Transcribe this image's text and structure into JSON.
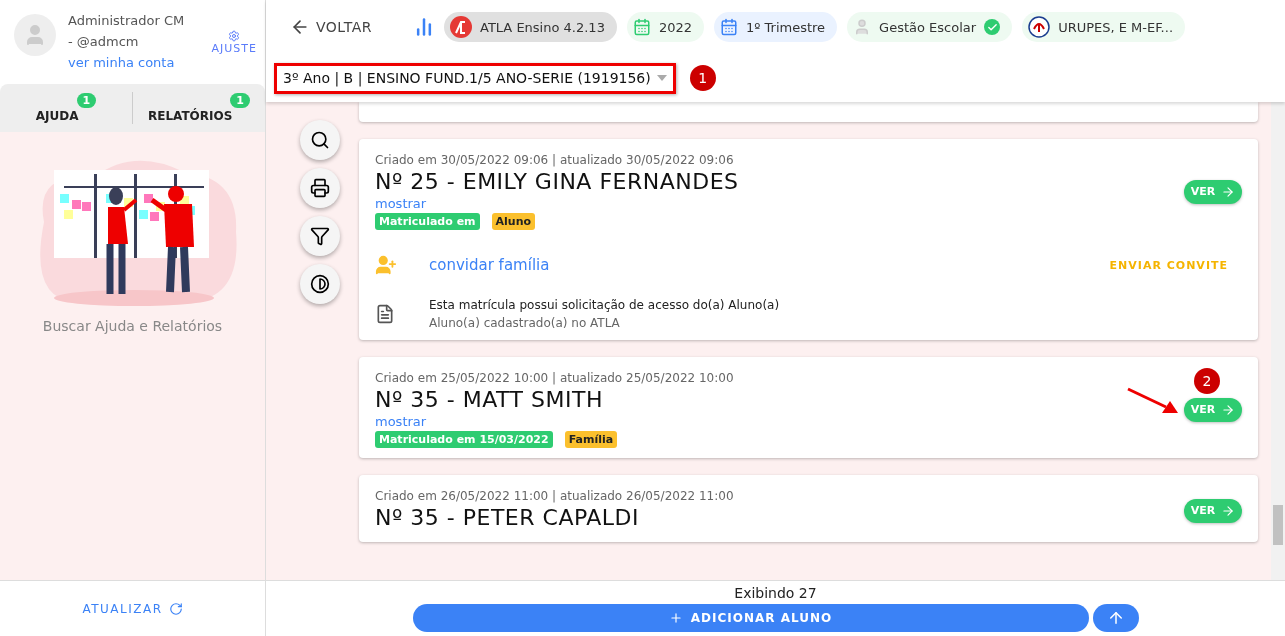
{
  "sidebar": {
    "user": {
      "name": "Administrador CM",
      "handle": "- @admcm",
      "link": "ver minha conta"
    },
    "settings": "AJUSTE",
    "tabs": [
      {
        "label": "AJUDA",
        "badge": "1"
      },
      {
        "label": "RELATÓRIOS",
        "badge": "1"
      }
    ],
    "empty_state": "Buscar Ajuda e Relatórios",
    "refresh": "ATUALIZAR"
  },
  "topbar": {
    "back": "VOLTAR",
    "chips": [
      {
        "kind": "app",
        "label": "ATLA Ensino 4.2.13"
      },
      {
        "kind": "year",
        "label": "2022"
      },
      {
        "kind": "period",
        "label": "1º Trimestre"
      },
      {
        "kind": "module",
        "label": "Gestão Escolar",
        "verified": true
      },
      {
        "kind": "school",
        "label": "URUPES, E M-EF..."
      }
    ]
  },
  "class_selector": {
    "value": "3º Ano | B | ENSINO FUND.1/5 ANO-SERIE (1919156)",
    "marker": "1"
  },
  "cards": [
    {
      "created": "Criado em 30/05/2022 09:06 | atualizado 30/05/2022 09:06",
      "title": "Nº 25 - EMILY GINA FERNANDES",
      "toggle": "mostrar",
      "button": "VER",
      "tags": [
        {
          "label": "Matriculado em",
          "color": "#2ecc71"
        },
        {
          "label": "Aluno",
          "color": "#fbc02d"
        }
      ],
      "invite": {
        "label": "convidar família",
        "action": "ENVIAR CONVITE"
      },
      "note": {
        "title": "Esta matrícula possui solicitação de acesso do(a) Aluno(a)",
        "subtitle": "Aluno(a) cadastrado(a) no ATLA"
      }
    },
    {
      "created": "Criado em 25/05/2022 10:00 | atualizado 25/05/2022 10:00",
      "title": "Nº 35 - MATT SMITH",
      "toggle": "mostrar",
      "button": "VER",
      "marker": "2",
      "tags": [
        {
          "label": "Matriculado em 15/03/2022",
          "color": "#2ecc71"
        },
        {
          "label": "Família",
          "color": "#fbc02d"
        }
      ]
    },
    {
      "created": "Criado em 26/05/2022 11:00 | atualizado 26/05/2022 11:00",
      "title": "Nº 35 - PETER CAPALDI",
      "button": "VER"
    }
  ],
  "footer": {
    "count": "Exibindo 27",
    "add": "ADICIONAR ALUNO"
  }
}
